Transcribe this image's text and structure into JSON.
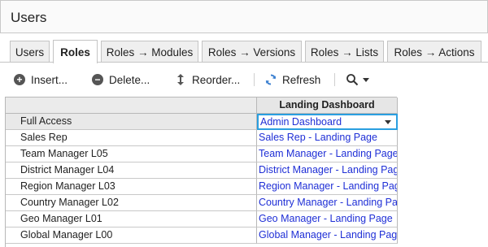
{
  "window": {
    "title": "Users"
  },
  "tabs": [
    {
      "label": "Users"
    },
    {
      "label": "Roles"
    },
    {
      "label": "Roles → Modules"
    },
    {
      "label": "Roles → Versions"
    },
    {
      "label": "Roles → Lists"
    },
    {
      "label": "Roles → Actions"
    }
  ],
  "toolbar": {
    "insert_label": "Insert...",
    "delete_label": "Delete...",
    "reorder_label": "Reorder...",
    "refresh_label": "Refresh"
  },
  "grid": {
    "column_header": "Landing Dashboard",
    "rows": [
      {
        "name": "Full Access",
        "value": "Admin Dashboard"
      },
      {
        "name": "Sales Rep",
        "value": "Sales Rep - Landing Page"
      },
      {
        "name": "Team Manager L05",
        "value": "Team Manager - Landing Page"
      },
      {
        "name": "District Manager L04",
        "value": "District Manager - Landing Page"
      },
      {
        "name": "Region Manager L03",
        "value": "Region Manager - Landing Page"
      },
      {
        "name": "Country Manager L02",
        "value": "Country Manager - Landing Page"
      },
      {
        "name": "Geo Manager L01",
        "value": "Geo Manager - Landing Page"
      },
      {
        "name": "Global Manager L00",
        "value": "Global Manager - Landing Page"
      }
    ]
  },
  "colors": {
    "accent": "#2a9fe0",
    "link": "#1f2fd6"
  }
}
